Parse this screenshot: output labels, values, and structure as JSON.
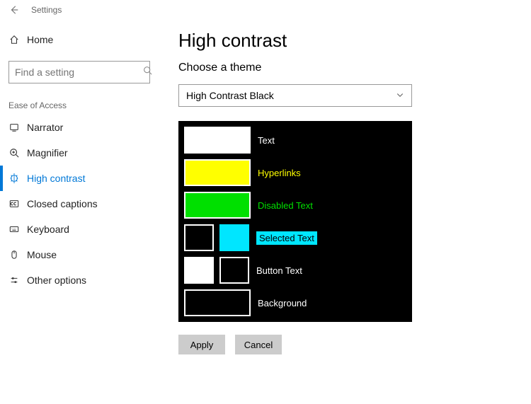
{
  "titlebar": {
    "app_title": "Settings"
  },
  "sidebar": {
    "home_label": "Home",
    "search_placeholder": "Find a setting",
    "section_label": "Ease of Access",
    "items": [
      {
        "label": "Narrator",
        "active": false
      },
      {
        "label": "Magnifier",
        "active": false
      },
      {
        "label": "High contrast",
        "active": true
      },
      {
        "label": "Closed captions",
        "active": false
      },
      {
        "label": "Keyboard",
        "active": false
      },
      {
        "label": "Mouse",
        "active": false
      },
      {
        "label": "Other options",
        "active": false
      }
    ]
  },
  "main": {
    "title": "High contrast",
    "choose_label": "Choose a theme",
    "selected_theme": "High Contrast Black",
    "preview": {
      "text": {
        "label": "Text",
        "color": "#ffffff",
        "text_color": "#ffffff"
      },
      "hyperlinks": {
        "label": "Hyperlinks",
        "color": "#ffff00",
        "text_color": "#ffff00"
      },
      "disabled_text": {
        "label": "Disabled Text",
        "color": "#00e000",
        "text_color": "#00e000"
      },
      "selected_text": {
        "label": "Selected Text",
        "fg": "#000000",
        "bg": "#00e6ff",
        "text_color": "#000000",
        "text_bg": "#00e6ff"
      },
      "button_text": {
        "label": "Button Text",
        "fg": "#ffffff",
        "bg": "#000000",
        "text_color": "#ffffff"
      },
      "background": {
        "label": "Background",
        "color": "#000000",
        "text_color": "#ffffff"
      }
    },
    "apply_label": "Apply",
    "cancel_label": "Cancel"
  }
}
